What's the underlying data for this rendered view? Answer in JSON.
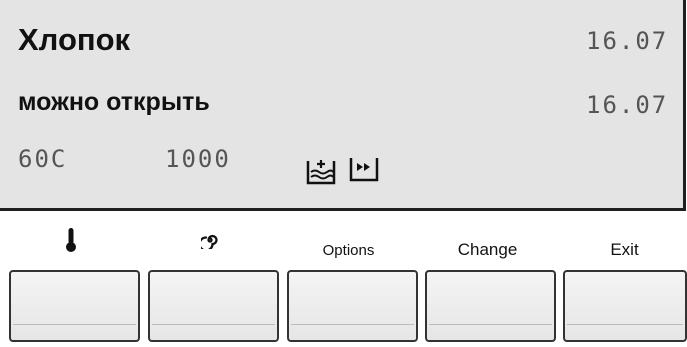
{
  "display": {
    "program": "Хлопок",
    "status": "можно открыть",
    "time1": "16.07",
    "time2": "16.07",
    "temperature": "60C",
    "spin": "1000",
    "status_icons": [
      "extra-rinse-icon",
      "quick-wash-icon"
    ]
  },
  "softkeys": [
    {
      "label": "",
      "icon": "thermometer-icon"
    },
    {
      "label": "",
      "icon": "spin-icon"
    },
    {
      "label": "Options"
    },
    {
      "label": "Change"
    },
    {
      "label": "Exit"
    }
  ],
  "colors": {
    "lcd_bg": "#e4e4e4",
    "text": "#111111",
    "segment": "#555555"
  }
}
